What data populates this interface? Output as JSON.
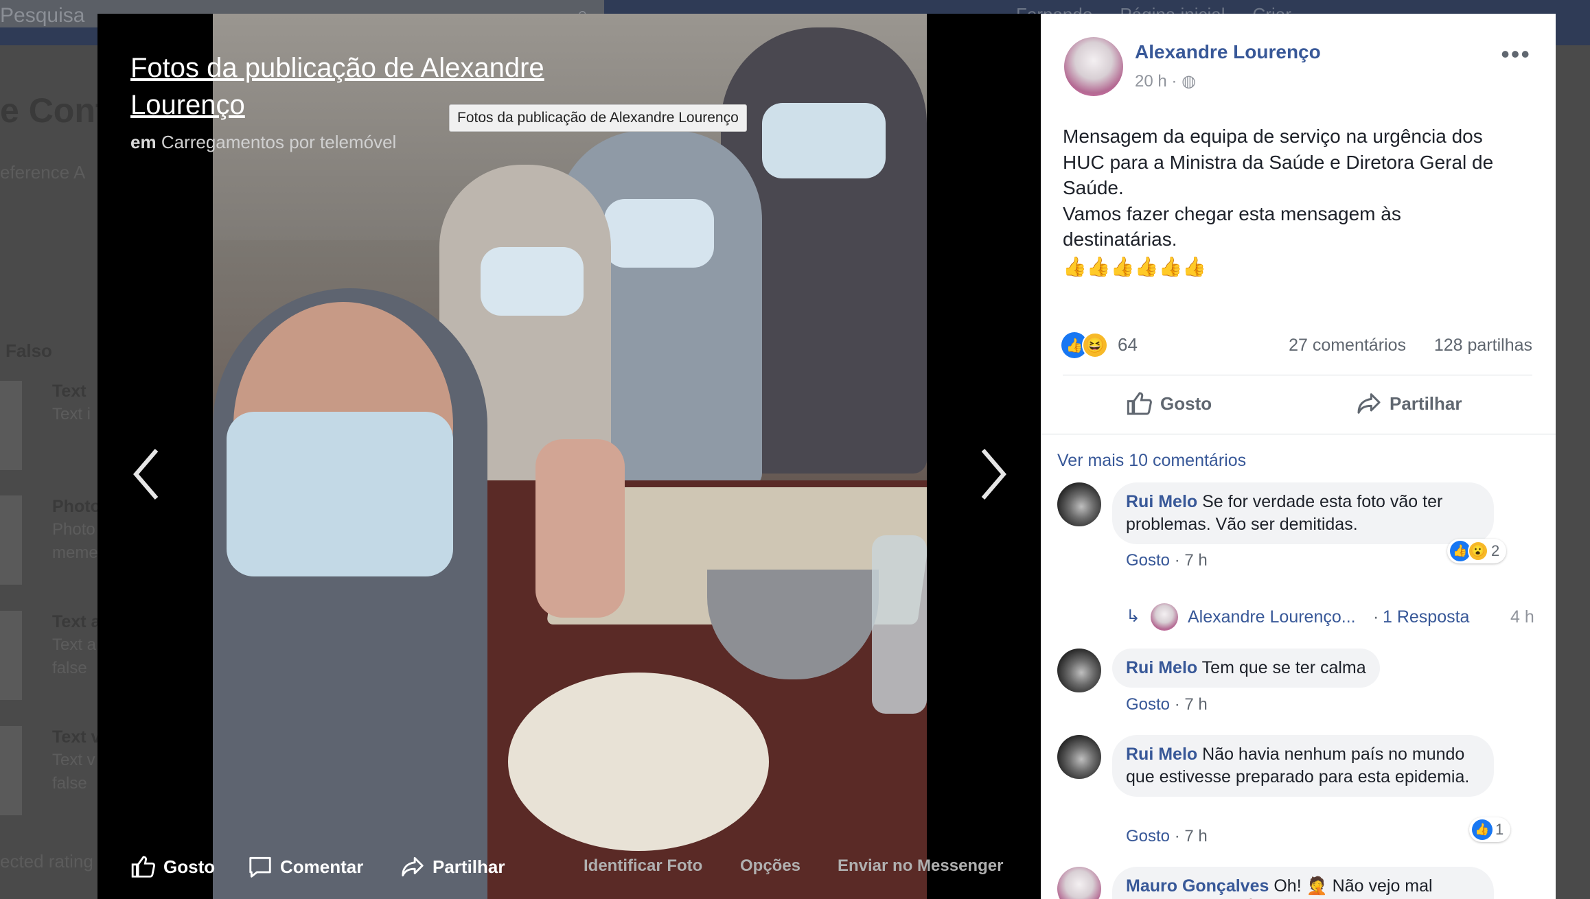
{
  "background": {
    "search_placeholder": "Pesquisa",
    "nav_items": [
      "Fernando",
      "Página inicial",
      "Criar"
    ],
    "page_heading": "e Cont",
    "subtitle": "eference A",
    "section_label": "Falso",
    "side_items": [
      {
        "title": "Text",
        "line1": "Text i",
        "line2": ""
      },
      {
        "title": "Photo",
        "line1": "Photo",
        "line2": "meme"
      },
      {
        "title": "Text a",
        "line1": "Text a",
        "line2": "false"
      },
      {
        "title": "Text v",
        "line1": "Text v",
        "line2": "false"
      }
    ],
    "footer_text": "ected rating"
  },
  "stage": {
    "title": "Fotos da publicação de Alexandre Lourenço",
    "subtitle_prefix": "em",
    "subtitle_album": "Carregamentos por telemóvel",
    "tooltip": "Fotos da publicação de Alexandre Lourenço",
    "actions": {
      "like": "Gosto",
      "comment": "Comentar",
      "share": "Partilhar",
      "tag": "Identificar Foto",
      "options": "Opções",
      "messenger": "Enviar no Messenger"
    }
  },
  "post": {
    "author": "Alexandre Lourenço",
    "time": "20 h",
    "visibility_icon": "globe-icon",
    "text_lines": [
      "Mensagem da equipa de serviço na urgência dos",
      "HUC para a Ministra da Saúde e Diretora Geral de",
      "Saúde.",
      "Vamos fazer chegar esta mensagem às",
      "destinatárias."
    ],
    "emojis": "👍👍👍👍👍👍",
    "reaction_count": "64",
    "comments_count": "27 comentários",
    "shares_count": "128 partilhas",
    "like_label": "Gosto",
    "share_label": "Partilhar"
  },
  "comments": {
    "more_label": "Ver mais 10 comentários",
    "items": [
      {
        "name": "Rui Melo",
        "text": "Se for verdade esta foto vão ter problemas. Vão ser demitidas.",
        "like": "Gosto",
        "time": "7 h",
        "reactions": "2"
      },
      {
        "name": "Rui Melo",
        "text": "Tem que se ter calma",
        "like": "Gosto",
        "time": "7 h"
      },
      {
        "name": "Rui Melo",
        "text": "Não havia nenhum país no mundo que estivesse preparado para esta epidemia.",
        "like": "Gosto",
        "time": "7 h",
        "reactions": "1"
      },
      {
        "name": "Mauro Gonçalves",
        "text": "Oh! 🤦 Não vejo mal algum na foto! 🤦 Apenas vejo um grupo"
      }
    ],
    "reply": {
      "author": "Alexandre Lourenço...",
      "replies": "1 Resposta",
      "time": "4 h"
    }
  },
  "colors": {
    "link": "#385898",
    "like_blue": "#1877f2"
  }
}
